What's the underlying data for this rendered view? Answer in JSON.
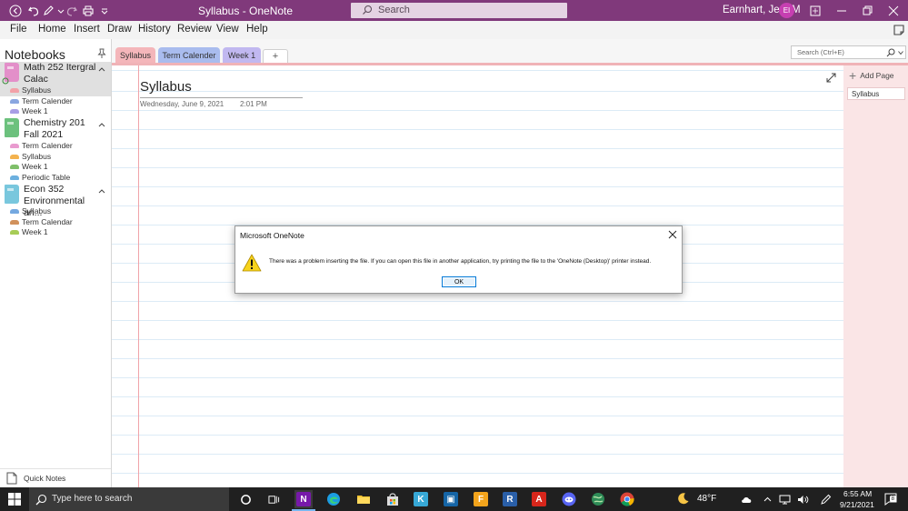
{
  "window": {
    "title": "Syllabus  -  OneNote",
    "search_placeholder": "Search",
    "user_name": "Earnhart, Jerri M",
    "user_initials": "EI"
  },
  "menu": [
    "File",
    "Home",
    "Insert",
    "Draw",
    "History",
    "Review",
    "View",
    "Help"
  ],
  "notebooks_header": "Notebooks",
  "notebooks": [
    {
      "title": "Math 252 Itergral Calac",
      "color": "#e38fc9",
      "sections": [
        {
          "label": "Syllabus",
          "color": "#f2a1a8"
        },
        {
          "label": "Term Calender",
          "color": "#8aa6e0"
        },
        {
          "label": "Week 1",
          "color": "#a99ee6"
        }
      ]
    },
    {
      "title": "Chemistry 201 Fall 2021",
      "color": "#6cc17d",
      "sections": [
        {
          "label": "Term Calender",
          "color": "#e99bcf"
        },
        {
          "label": "Syllabus",
          "color": "#f3b24e"
        },
        {
          "label": "Week 1",
          "color": "#7fbf6a"
        },
        {
          "label": "Periodic Table",
          "color": "#6cb0df"
        }
      ]
    },
    {
      "title": "Econ 352 Environmental an...",
      "color": "#79c7dd",
      "sections": [
        {
          "label": "Syllabus",
          "color": "#74a8e0"
        },
        {
          "label": "Term Calendar",
          "color": "#d1915c"
        },
        {
          "label": "Week 1",
          "color": "#a7cc57"
        }
      ]
    }
  ],
  "quick_notes": "Quick Notes",
  "section_tabs": [
    {
      "label": "Syllabus",
      "color": "#f4b6ba"
    },
    {
      "label": "Term Calender",
      "color": "#a9bcee"
    },
    {
      "label": "Week 1",
      "color": "#c1b8f0"
    }
  ],
  "add_tab_label": "+",
  "page_search_placeholder": "Search (Ctrl+E)",
  "page": {
    "title": "Syllabus",
    "date": "Wednesday, June 9, 2021",
    "time": "2:01 PM"
  },
  "page_list": {
    "add_page": "Add Page",
    "pages": [
      "Syllabus"
    ]
  },
  "dialog": {
    "title": "Microsoft OneNote",
    "message": "There was a problem inserting the file. If you can open this file in another application, try printing the file to the 'OneNote (Desktop)' printer instead.",
    "ok": "OK"
  },
  "taskbar": {
    "search_placeholder": "Type here to search",
    "temperature": "48°F",
    "time": "6:55 AM",
    "date": "9/21/2021",
    "notification_count": "8"
  },
  "colors": {
    "onenote_purple": "#80397b",
    "tab_pink": "#f0b3b7",
    "page_list_bg": "#fae5e6",
    "accent_blue": "#0078d7"
  }
}
